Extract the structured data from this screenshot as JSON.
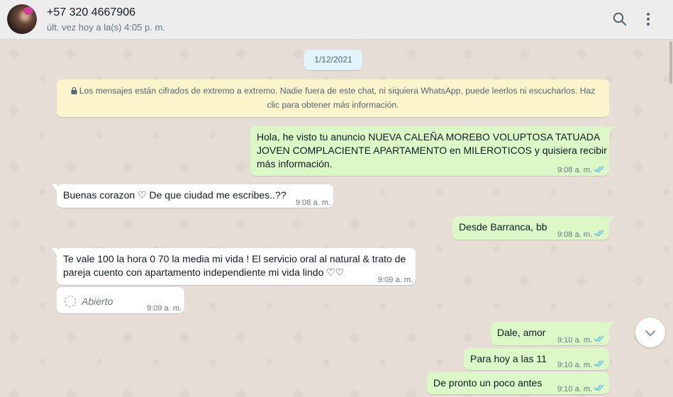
{
  "header": {
    "contact_name": "+57 320 4667906",
    "contact_status": "últ. vez hoy a la(s) 4:05 p. m.",
    "icons": [
      "search-icon",
      "menu-icon"
    ]
  },
  "chat": {
    "date_label": "1/12/2021",
    "encryption_notice": "Los mensajes están cifrados de extremo a extremo. Nadie fuera de este chat, ni siquiera WhatsApp, puede leerlos ni escucharlos. Haz",
    "encryption_notice_2": "clic para obtener más información.",
    "messages": [
      {
        "direction": "out",
        "lines": [
          "Hola, he visto tu anuncio NUEVA CALEÑA MOREBO VOLUPTOSA TATUADA",
          "JOVEN COMPLACIENTE APARTAMENTO en MILEROTICOS y quisiera recibir",
          "más información."
        ],
        "time": "9:08 a. m.",
        "status": "read"
      },
      {
        "direction": "in",
        "lines": [
          "Buenas  corazon ♡ De que ciudad me escribes..??"
        ],
        "time": "9:08 a. m."
      },
      {
        "direction": "out",
        "lines": [
          "Desde Barranca, bb"
        ],
        "time": "9:08 a. m.",
        "status": "read"
      },
      {
        "direction": "in",
        "lines": [
          "Te vale 100 la hora 0 70 la media mi vida ! El servicio oral al natural & trato de",
          "pareja cuento con apartamento independiente mi vida lindo ♡♡"
        ],
        "time": "9:09 a. m."
      },
      {
        "direction": "in",
        "type": "audio",
        "label": "Abierto",
        "time": "9:09 a. m."
      },
      {
        "direction": "out",
        "lines": [
          "Dale, amor"
        ],
        "time": "9:10 a. m.",
        "status": "read"
      },
      {
        "direction": "out",
        "lines": [
          "Para hoy a las 11"
        ],
        "time": "9:10 a. m.",
        "status": "read"
      },
      {
        "direction": "out",
        "lines": [
          "De pronto un poco antes"
        ],
        "time": "9:10 a. m.",
        "status": "read"
      }
    ]
  },
  "colors": {
    "outgoing_bubble": "#dcf8c6",
    "incoming_bubble": "#ffffff",
    "read_ticks": "#53bdeb",
    "encryption_bg": "#fcf4cb",
    "date_chip_bg": "#e1f3fb"
  }
}
